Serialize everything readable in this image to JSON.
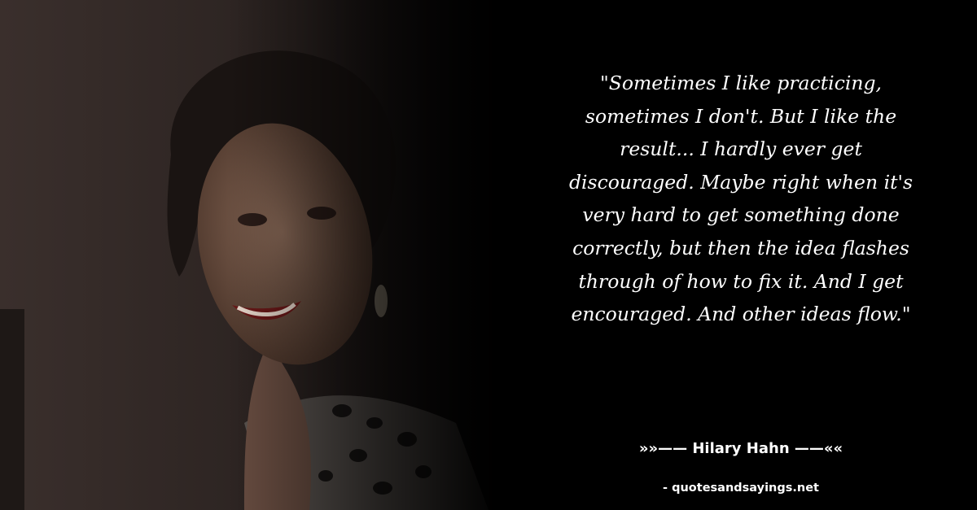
{
  "quote": {
    "lines": [
      "\"Sometimes I like practicing,",
      "sometimes I don't. But I like the",
      "result... I hardly ever get",
      "discouraged. Maybe right when it's",
      "very hard to get something done",
      "correctly, but then the idea flashes",
      "through of how to fix it. And I get",
      "encouraged. And other ideas flow.\""
    ]
  },
  "attribution": {
    "text": "»»—— Hilary Hahn ——««"
  },
  "source": {
    "text": "- quotesandsayings.net"
  },
  "colors": {
    "background": "#000000",
    "text": "#ffffff"
  }
}
